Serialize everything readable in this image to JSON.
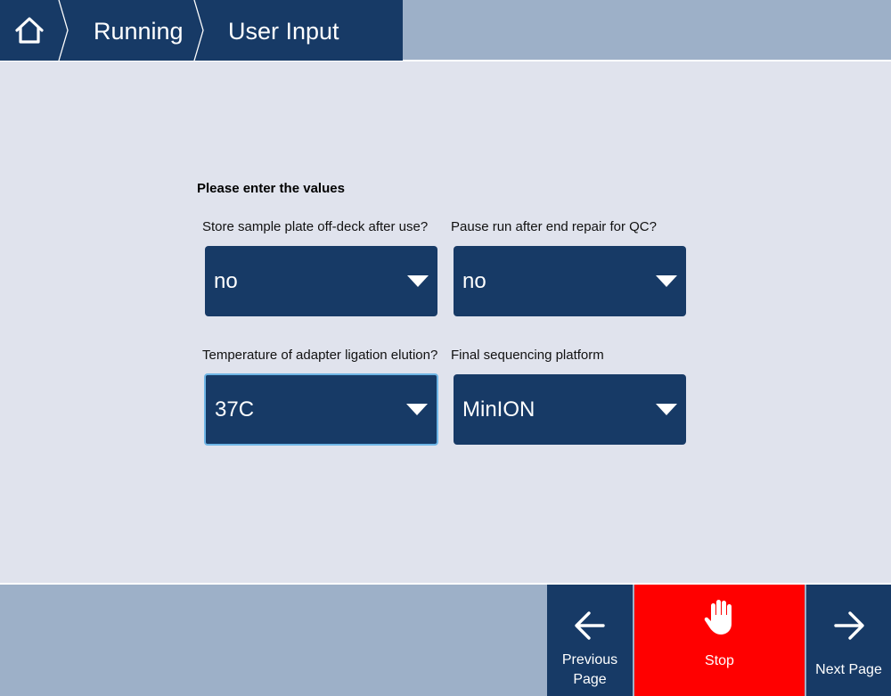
{
  "header": {
    "home_icon": "home-icon",
    "breadcrumbs": [
      {
        "label": "Running"
      },
      {
        "label": "User Input"
      }
    ]
  },
  "form": {
    "title": "Please enter the values",
    "fields": [
      {
        "label": "Store sample plate off-deck after use?",
        "value": "no"
      },
      {
        "label": "Pause run after end repair for QC?",
        "value": "no"
      },
      {
        "label": "Temperature of adapter ligation elution?",
        "value": "37C"
      },
      {
        "label": "Final sequencing platform",
        "value": "MinION"
      }
    ]
  },
  "footer": {
    "previous_label": "Previous Page",
    "stop_label": "Stop",
    "next_label": "Next Page"
  },
  "colors": {
    "primary": "#173a66",
    "bar": "#9db0c8",
    "background": "#e0e3ed",
    "stop": "#ff0000",
    "focus": "#6fb6e6"
  }
}
